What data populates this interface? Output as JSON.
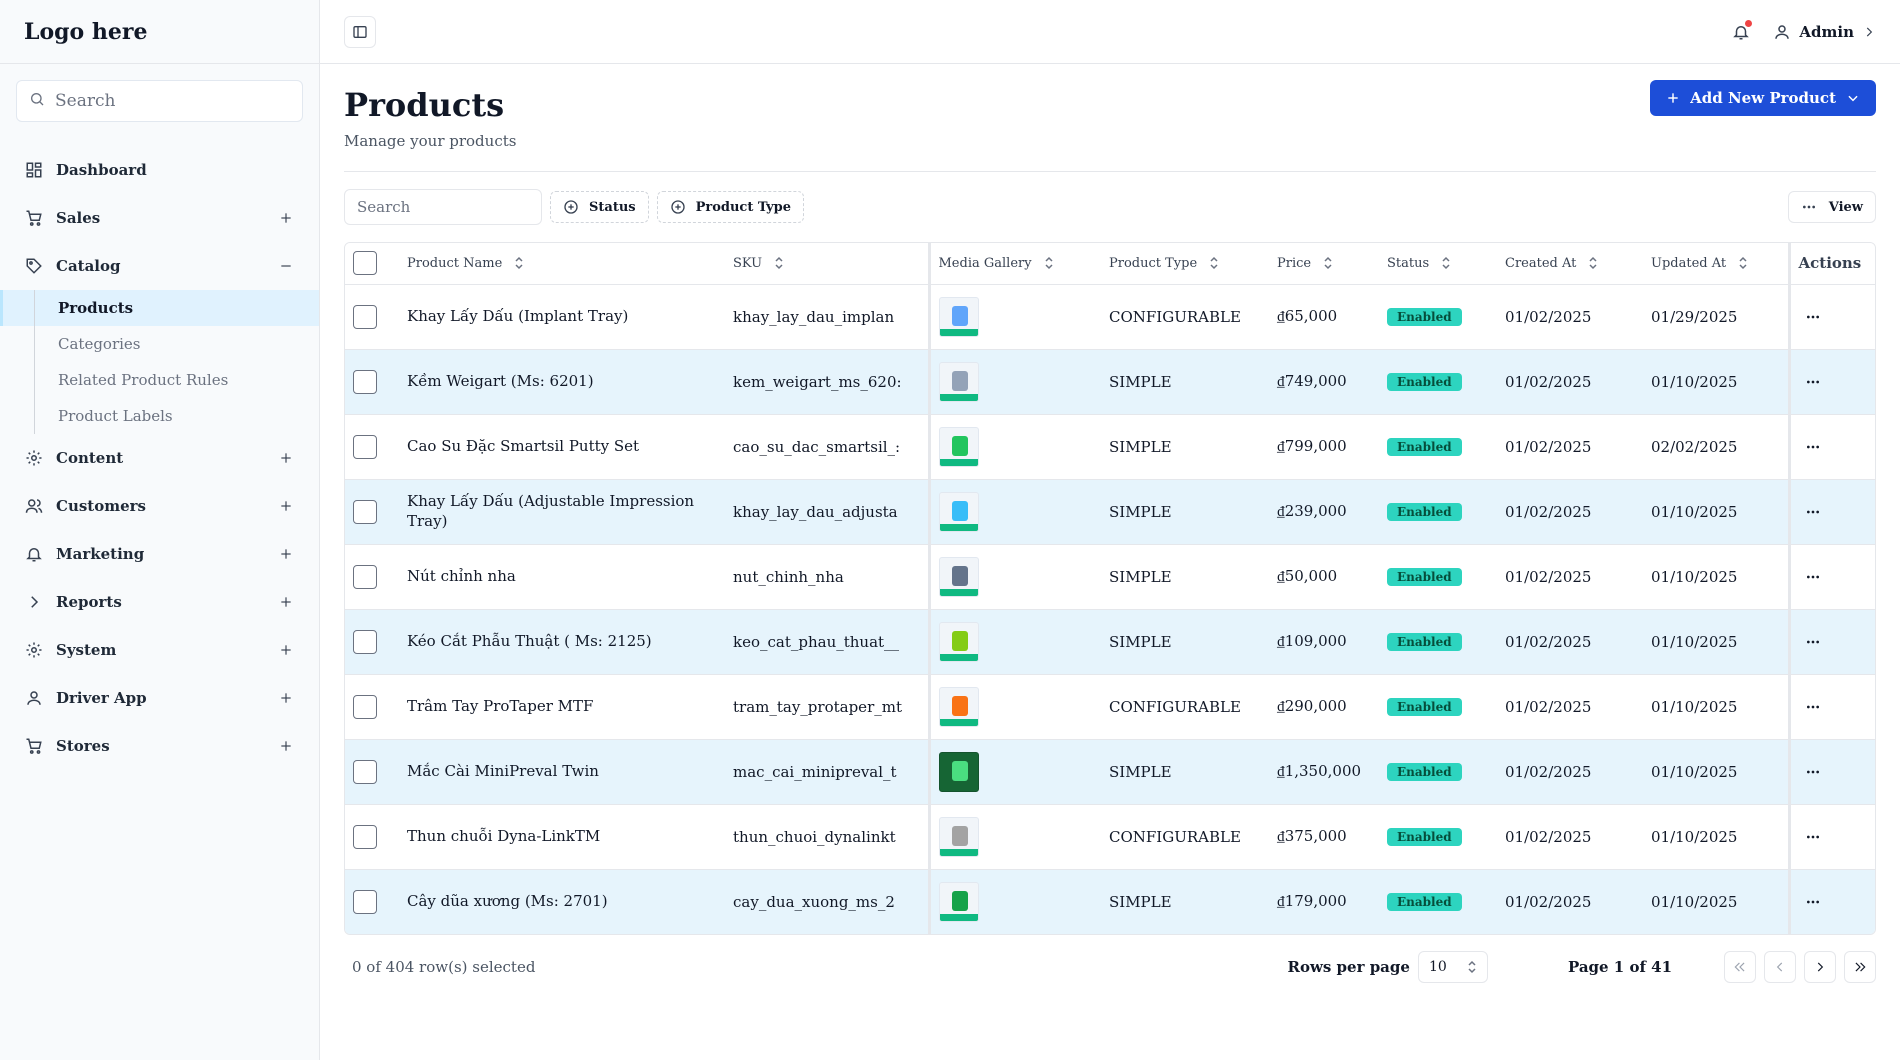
{
  "sidebar": {
    "logo": "Logo here",
    "search_placeholder": "Search",
    "nav": [
      {
        "label": "Dashboard",
        "icon": "dashboard-icon"
      },
      {
        "label": "Sales",
        "icon": "cart-icon"
      },
      {
        "label": "Catalog",
        "icon": "tag-icon"
      },
      {
        "label": "Content",
        "icon": "gear-icon"
      },
      {
        "label": "Customers",
        "icon": "users-icon"
      },
      {
        "label": "Marketing",
        "icon": "bell-icon"
      },
      {
        "label": "Reports",
        "icon": "chevron-right-icon"
      },
      {
        "label": "System",
        "icon": "gear-icon"
      },
      {
        "label": "Driver App",
        "icon": "user-icon"
      },
      {
        "label": "Stores",
        "icon": "cart-icon"
      }
    ],
    "catalog_sub": [
      "Products",
      "Categories",
      "Related Product Rules",
      "Product Labels"
    ]
  },
  "topbar": {
    "user": "Admin"
  },
  "page": {
    "title": "Products",
    "subtitle": "Manage your products",
    "add_button": "Add New Product"
  },
  "toolbar": {
    "search_placeholder": "Search",
    "filter_status": "Status",
    "filter_type": "Product Type",
    "view": "View"
  },
  "table": {
    "columns": {
      "name": "Product Name",
      "sku": "SKU",
      "media": "Media Gallery",
      "type": "Product Type",
      "price": "Price",
      "status": "Status",
      "created": "Created At",
      "updated": "Updated At",
      "actions": "Actions"
    },
    "rows": [
      {
        "name": "Khay Lấy Dấu (Implant Tray)",
        "sku": "khay_lay_dau_implan",
        "type": "CONFIGURABLE",
        "price": "₫65,000",
        "status": "Enabled",
        "created": "01/02/2025",
        "updated": "01/29/2025"
      },
      {
        "name": "Kềm Weigart (Ms: 6201)",
        "sku": "kem_weigart_ms_620:",
        "type": "SIMPLE",
        "price": "₫749,000",
        "status": "Enabled",
        "created": "01/02/2025",
        "updated": "01/10/2025"
      },
      {
        "name": "Cao Su Đặc Smartsil Putty Set",
        "sku": "cao_su_dac_smartsil_:",
        "type": "SIMPLE",
        "price": "₫799,000",
        "status": "Enabled",
        "created": "01/02/2025",
        "updated": "02/02/2025"
      },
      {
        "name": "Khay Lấy Dấu (Adjustable Impression Tray)",
        "sku": "khay_lay_dau_adjusta",
        "type": "SIMPLE",
        "price": "₫239,000",
        "status": "Enabled",
        "created": "01/02/2025",
        "updated": "01/10/2025"
      },
      {
        "name": "Nút chỉnh nha",
        "sku": "nut_chinh_nha",
        "type": "SIMPLE",
        "price": "₫50,000",
        "status": "Enabled",
        "created": "01/02/2025",
        "updated": "01/10/2025"
      },
      {
        "name": "Kéo Cắt Phẫu Thuật ( Ms: 2125)",
        "sku": "keo_cat_phau_thuat__",
        "type": "SIMPLE",
        "price": "₫109,000",
        "status": "Enabled",
        "created": "01/02/2025",
        "updated": "01/10/2025"
      },
      {
        "name": "Trâm Tay ProTaper MTF",
        "sku": "tram_tay_protaper_mt",
        "type": "CONFIGURABLE",
        "price": "₫290,000",
        "status": "Enabled",
        "created": "01/02/2025",
        "updated": "01/10/2025"
      },
      {
        "name": "Mắc Cài MiniPreval Twin",
        "sku": "mac_cai_minipreval_t",
        "type": "SIMPLE",
        "price": "₫1,350,000",
        "status": "Enabled",
        "created": "01/02/2025",
        "updated": "01/10/2025"
      },
      {
        "name": "Thun chuỗi Dyna-LinkTM",
        "sku": "thun_chuoi_dynalinkt",
        "type": "CONFIGURABLE",
        "price": "₫375,000",
        "status": "Enabled",
        "created": "01/02/2025",
        "updated": "01/10/2025"
      },
      {
        "name": "Cây dũa xương (Ms: 2701)",
        "sku": "cay_dua_xuong_ms_2",
        "type": "SIMPLE",
        "price": "₫179,000",
        "status": "Enabled",
        "created": "01/02/2025",
        "updated": "01/10/2025"
      }
    ]
  },
  "footer": {
    "selected": "0 of 404 row(s) selected",
    "rows_per_page_label": "Rows per page",
    "rows_per_page": "10",
    "page_info": "Page 1 of 41"
  },
  "colors": {
    "accent": "#1d4ed8",
    "badge": "#2dd4bf",
    "row_alt": "#e6f4fc",
    "active_nav": "#e0f2fe"
  }
}
